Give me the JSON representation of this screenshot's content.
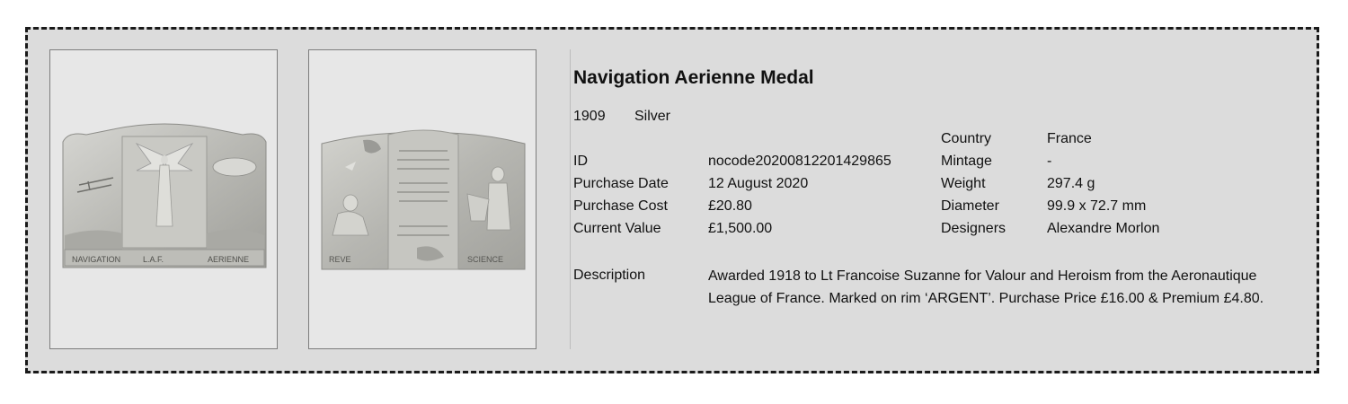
{
  "medal": {
    "title": "Navigation Aerienne Medal",
    "year": "1909",
    "metal": "Silver"
  },
  "images": {
    "obverse": {
      "icon": "medal-obverse-photo",
      "inscription": [
        "NAVIGATION",
        "L.A.F.",
        "AERIENNE"
      ]
    },
    "reverse": {
      "icon": "medal-reverse-photo",
      "inscription": [
        "REVE",
        "SCIENCE"
      ]
    }
  },
  "fields": {
    "id": {
      "label": "ID",
      "value": "nocode20200812201429865"
    },
    "purchase_date": {
      "label": "Purchase Date",
      "value": "12 August 2020"
    },
    "purchase_cost": {
      "label": "Purchase Cost",
      "value": "£20.80"
    },
    "current_value": {
      "label": "Current Value",
      "value": "£1,500.00"
    },
    "country": {
      "label": "Country",
      "value": "France"
    },
    "mintage": {
      "label": "Mintage",
      "value": "-"
    },
    "weight": {
      "label": "Weight",
      "value": "297.4 g"
    },
    "diameter": {
      "label": "Diameter",
      "value": "99.9 x 72.7 mm"
    },
    "designers": {
      "label": "Designers",
      "value": "Alexandre Morlon"
    }
  },
  "description": {
    "label": "Description",
    "text": "Awarded 1918 to Lt Francoise Suzanne for Valour and Heroism from the Aeronautique League of France.  Marked on rim ‘ARGENT’.  Purchase Price £16.00 & Premium £4.80."
  },
  "colors": {
    "card_background": "#dcdcdc",
    "border": "#1a1a1a",
    "silver": "#c4c4bf"
  }
}
